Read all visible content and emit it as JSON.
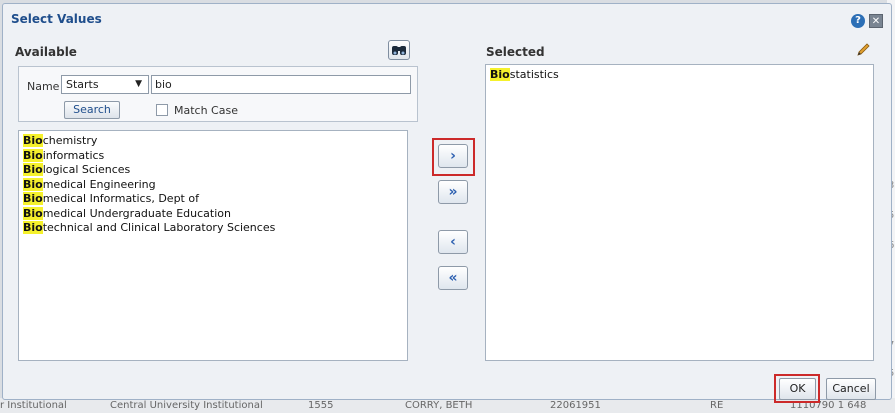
{
  "dialog": {
    "title": "Select Values"
  },
  "available": {
    "heading": "Available",
    "search": {
      "name_label": "Name",
      "operator": "Starts",
      "term": "bio",
      "search_button": "Search",
      "match_case_label": "Match Case",
      "match_case_checked": false
    },
    "items": [
      {
        "match": "Bio",
        "rest": "chemistry"
      },
      {
        "match": "Bio",
        "rest": "informatics"
      },
      {
        "match": "Bio",
        "rest": "logical Sciences"
      },
      {
        "match": "Bio",
        "rest": "medical Engineering"
      },
      {
        "match": "Bio",
        "rest": "medical Informatics, Dept of"
      },
      {
        "match": "Bio",
        "rest": "medical Undergraduate Education"
      },
      {
        "match": "Bio",
        "rest": "technical and Clinical Laboratory Sciences"
      }
    ]
  },
  "selected": {
    "heading": "Selected",
    "items": [
      {
        "match": "Bio",
        "rest": "statistics"
      }
    ]
  },
  "move_buttons": {
    "move_right": "›",
    "move_all_right": "»",
    "move_left": "‹",
    "move_all_left": "«"
  },
  "footer": {
    "ok_label": "OK",
    "cancel_label": "Cancel"
  },
  "background": {
    "row_cells": [
      "r Institutional",
      "Central University Institutional",
      "1555",
      "CORRY, BETH",
      "22061951",
      "RE",
      "1110790 1 648"
    ]
  },
  "icons": {
    "help": "help-icon",
    "close": "close-icon",
    "binoculars": "binoculars-icon",
    "pencil": "pencil-icon"
  },
  "colors": {
    "accent": "#1f4e8c",
    "highlight": "#f5f12c",
    "focus_outline": "#cc2a2a"
  }
}
